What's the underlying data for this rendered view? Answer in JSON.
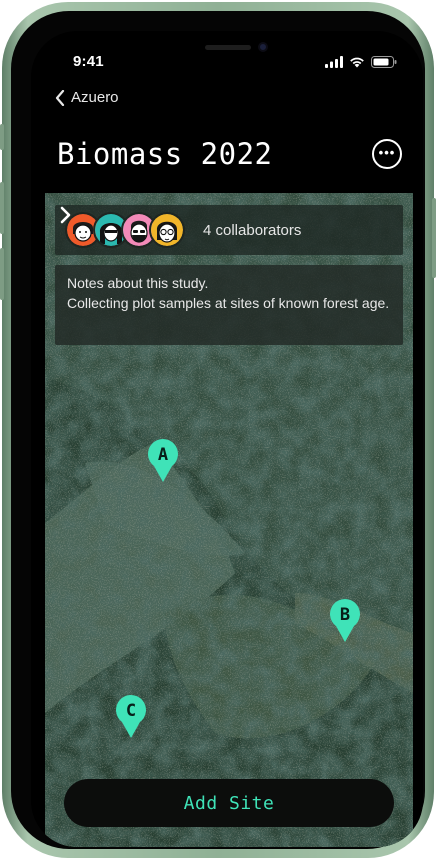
{
  "status_bar": {
    "time": "9:41"
  },
  "nav": {
    "back_label": "Azuero"
  },
  "header": {
    "title": "Biomass 2022",
    "more_icon": "ellipsis-circle-icon"
  },
  "collaborators": {
    "label": "4 collaborators",
    "avatar_colors": [
      "#ef5a2a",
      "#2bb9b0",
      "#f28ab8",
      "#f2b62a"
    ]
  },
  "notes": {
    "line1": "Notes about this study.",
    "line2": "Collecting plot samples at sites of known forest age."
  },
  "sites": [
    {
      "label": "A"
    },
    {
      "label": "B"
    },
    {
      "label": "C"
    }
  ],
  "pin_color": "#3fe3b8",
  "add_site_label": "Add Site"
}
